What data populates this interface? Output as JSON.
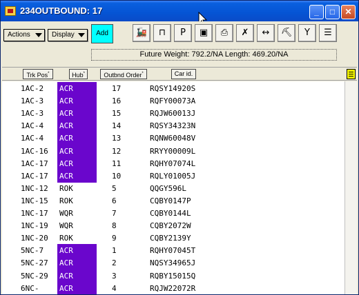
{
  "window": {
    "title": "234OUTBOUND: 17"
  },
  "toolbar": {
    "actions_label": "Actions",
    "display_label": "Display",
    "add_label": "Add",
    "status_text": "Future Weight: 792.2/NA  Length: 469.20/NA"
  },
  "columns": {
    "trk": "Trk Pos",
    "hub": "Hub",
    "ord": "Outbnd Order",
    "car": "Car id."
  },
  "highlight_color": "#6a06cc",
  "rows": [
    {
      "trk": "1AC-2",
      "hub": "ACR",
      "ord": "17",
      "car": "RQSY14920S",
      "hl": true
    },
    {
      "trk": "1AC-3",
      "hub": "ACR",
      "ord": "16",
      "car": "RQFY00073A",
      "hl": true
    },
    {
      "trk": "1AC-3",
      "hub": "ACR",
      "ord": "15",
      "car": "RQJW60013J",
      "hl": true
    },
    {
      "trk": "1AC-4",
      "hub": "ACR",
      "ord": "14",
      "car": "RQSY34323N",
      "hl": true
    },
    {
      "trk": "1AC-4",
      "hub": "ACR",
      "ord": "13",
      "car": "RQNW60048V",
      "hl": true
    },
    {
      "trk": "1AC-16",
      "hub": "ACR",
      "ord": "12",
      "car": "RRYY00009L",
      "hl": true
    },
    {
      "trk": "1AC-17",
      "hub": "ACR",
      "ord": "11",
      "car": "RQHY07074L",
      "hl": true
    },
    {
      "trk": "1AC-17",
      "hub": "ACR",
      "ord": "10",
      "car": "RQLY01005J",
      "hl": true
    },
    {
      "trk": "1NC-12",
      "hub": "ROK",
      "ord": "5",
      "car": "QQGY596L",
      "hl": false
    },
    {
      "trk": "1NC-15",
      "hub": "ROK",
      "ord": "6",
      "car": "CQBY0147P",
      "hl": false
    },
    {
      "trk": "1NC-17",
      "hub": "WQR",
      "ord": "7",
      "car": "CQBY0144L",
      "hl": false
    },
    {
      "trk": "1NC-19",
      "hub": "WQR",
      "ord": "8",
      "car": "CQBY2072W",
      "hl": false
    },
    {
      "trk": "1NC-20",
      "hub": "ROK",
      "ord": "9",
      "car": "CQBY2139Y",
      "hl": false
    },
    {
      "trk": "5NC-7",
      "hub": "ACR",
      "ord": "1",
      "car": "RQHY07045T",
      "hl": true
    },
    {
      "trk": "5NC-27",
      "hub": "ACR",
      "ord": "2",
      "car": "NQSY34965J",
      "hl": true
    },
    {
      "trk": "5NC-29",
      "hub": "ACR",
      "ord": "3",
      "car": "RQBY15015Q",
      "hl": true
    },
    {
      "trk": "6NC-",
      "hub": "ACR",
      "ord": "4",
      "car": "RQJW22072R",
      "hl": true
    }
  ]
}
